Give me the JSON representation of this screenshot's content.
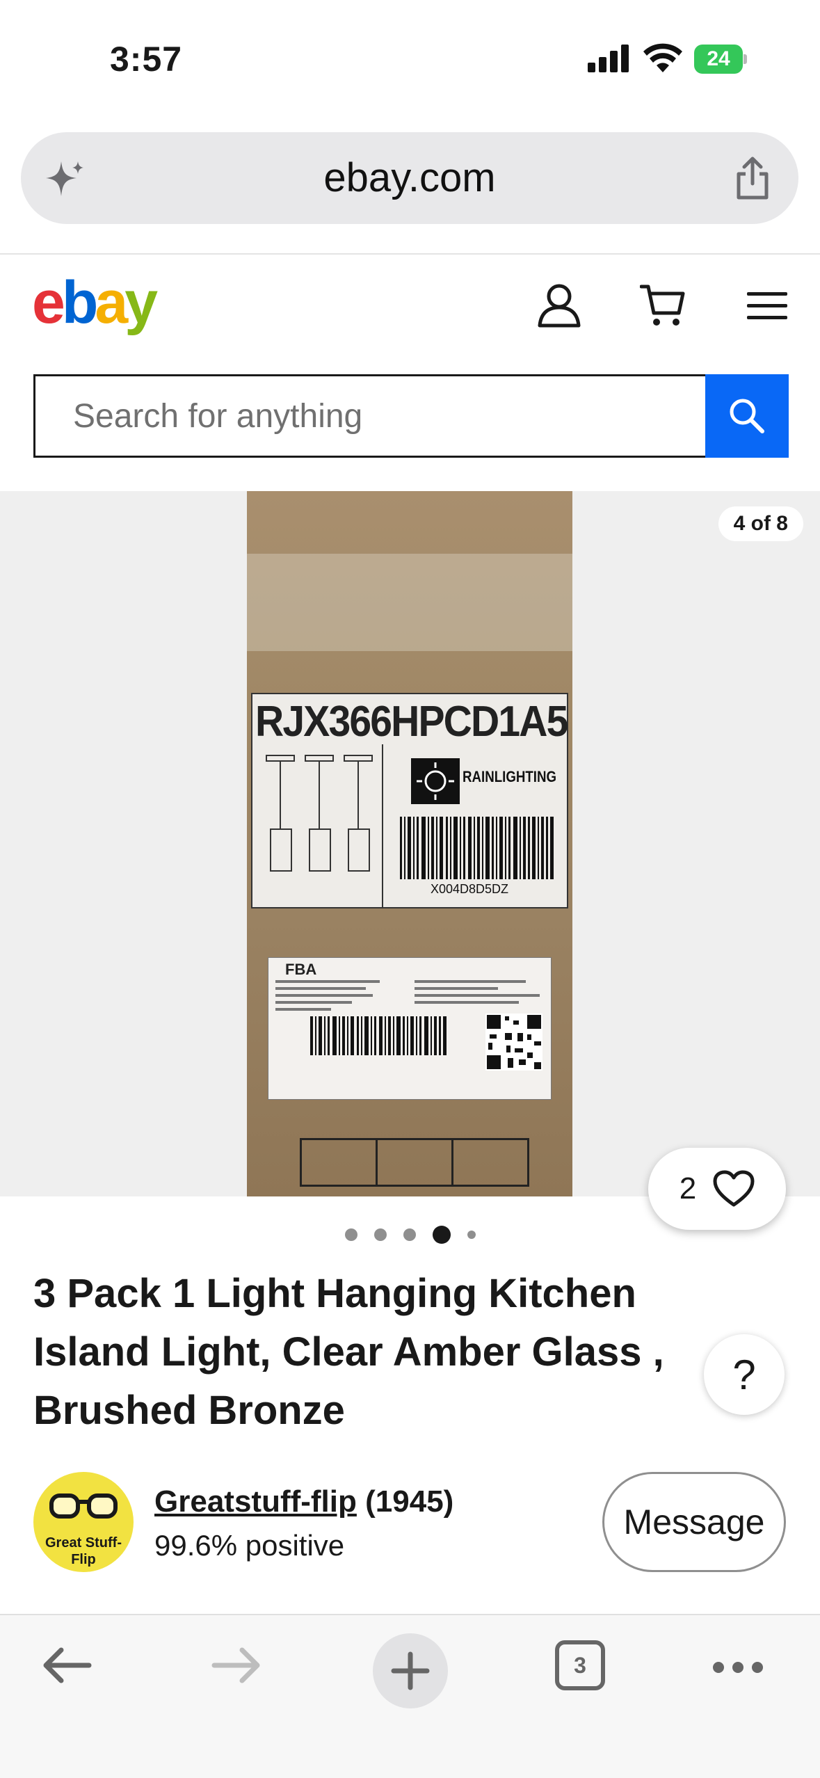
{
  "status_bar": {
    "time": "3:57",
    "battery": "24"
  },
  "browser": {
    "url_host": "ebay.com",
    "open_tabs": "3"
  },
  "header": {
    "logo": {
      "e": "e",
      "b": "b",
      "a": "a",
      "y": "y"
    },
    "search_placeholder": "Search for anything"
  },
  "gallery": {
    "counter": "4 of 8",
    "watch_count": "2",
    "box_label": {
      "code": "RJX366HPCD1A5",
      "brand": "RAINLIGHTING",
      "barcode_text": "X004D8D5DZ",
      "fba": "FBA"
    },
    "dots": 5,
    "active_dot": 4
  },
  "listing": {
    "title": "3 Pack 1 Light Hanging Kitchen Island Light, Clear Amber Glass , Brushed Bronze",
    "help": "?"
  },
  "seller": {
    "avatar_text": "Great Stuff-Flip",
    "name": "Greatstuff-flip",
    "feedback": "(1945)",
    "positive": "99.6% positive",
    "message_label": "Message"
  },
  "colors": {
    "ebay_red": "#e53238",
    "ebay_blue": "#0064d2",
    "ebay_yellow": "#f5af02",
    "ebay_green": "#86b817",
    "search_button": "#0968f6",
    "battery": "#34c759"
  }
}
